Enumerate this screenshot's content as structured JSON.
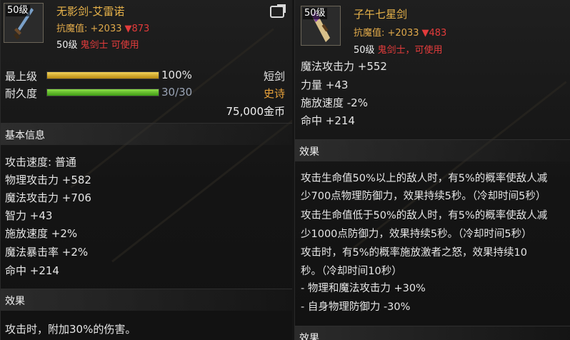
{
  "left": {
    "level_badge": "50级",
    "name": "无影剑-艾雷诺",
    "resist_label": "抗魔值: +2033",
    "resist_down": "▼873",
    "req_level": "50级",
    "req_class": "鬼剑士 可使用",
    "grade_label": "最上级",
    "grade_value": "100%",
    "grade_fraction": 1.0,
    "dur_label": "耐久度",
    "dur_value": "30/30",
    "dur_fraction": 1.0,
    "type": "短剑",
    "rarity": "史诗",
    "price": "75,000金币",
    "basic_title": "基本信息",
    "stats": [
      "攻击速度: 普通",
      "物理攻击力 +582",
      "魔法攻击力 +706",
      "智力 +43",
      "施放速度 +2%",
      "魔法暴击率 +2%",
      "命中 +214"
    ],
    "effect_title": "效果",
    "effect_text": "攻击时，附加30%的伤害。"
  },
  "right": {
    "level_badge": "50级",
    "name": "子午七星剑",
    "resist_label": "抗魔值: +2033",
    "resist_down": "▼483",
    "req_level": "50级",
    "req_class": "鬼剑士，可使用",
    "stats": [
      "魔法攻击力 +552",
      "力量 +43",
      "施放速度 -2%",
      "命中 +214"
    ],
    "effect_title": "效果",
    "effect_lines": [
      "攻击生命值50%以上的敌人时，有5%的概率使敌人减",
      "少700点物理防御力，效果持续5秒。（冷却时间5秒）",
      "攻击生命值低于50%的敌人时，有5%的概率使敌人减",
      "少1000点防御力，效果持续5秒。（冷却时间5秒）",
      "攻击时，有5%的概率施放激者之怒，效果持续10",
      "秒。（冷却时间10秒）",
      " - 物理和魔法攻击力 +30%",
      " - 自身物理防御力 -30%"
    ],
    "effect_title2": "效果"
  },
  "colors": {
    "item_name": "#e8b34a",
    "penalty": "#e23b3b",
    "class_req": "#e63c3c",
    "rarity": "#e8a23a"
  },
  "icons": [
    "share-icon",
    "sword-icon",
    "sword-icon"
  ]
}
